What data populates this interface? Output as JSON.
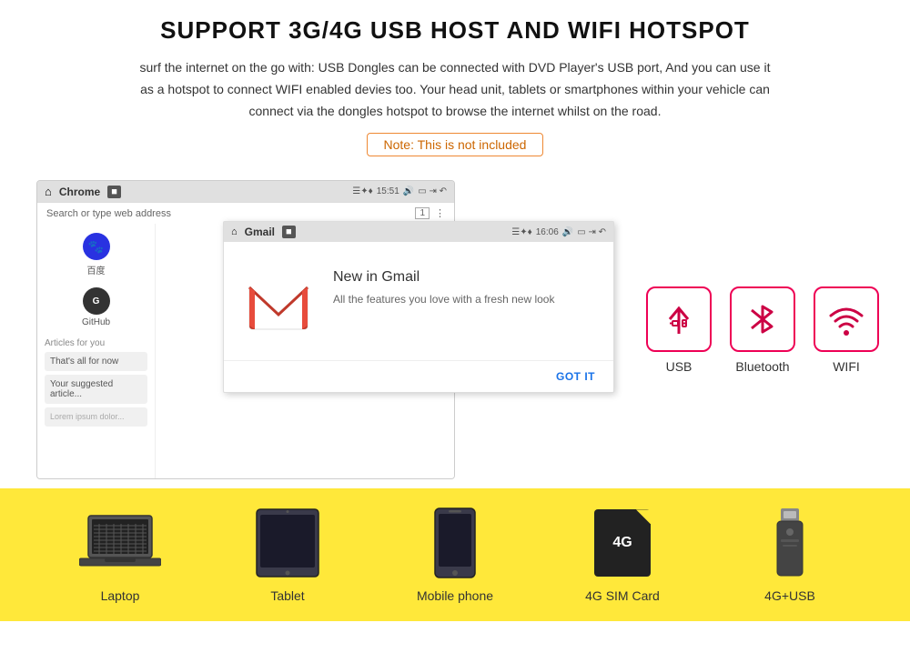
{
  "title": "SUPPORT 3G/4G USB HOST AND WIFI HOTSPOT",
  "description": "surf the internet on the go with: USB Dongles can be connected with DVD Player's USB port, And you can use it as a hotspot to connect WIFI enabled devies too. Your head unit, tablets or smartphones within your vehicle can connect via the dongles hotspot to browse the internet whilst on the road.",
  "note": "Note: This is not included",
  "browser": {
    "home_icon": "⌂",
    "title": "Chrome",
    "time": "15:51",
    "address_placeholder": "Search or type web address"
  },
  "gmail": {
    "title": "Gmail",
    "time": "16:06",
    "heading": "New in Gmail",
    "body": "All the features you love with a fresh new look",
    "cta": "GOT IT"
  },
  "sidebar_apps": [
    {
      "name": "百度",
      "icon": "🐾"
    },
    {
      "name": "GitHub",
      "icon": "G"
    }
  ],
  "articles_label": "Articles for you",
  "news_items": [
    "That's all for now",
    "Your suggested article..."
  ],
  "connectivity_icons": [
    {
      "label": "USB",
      "icon": "⚡",
      "type": "usb"
    },
    {
      "label": "Bluetooth",
      "icon": "✳",
      "type": "bluetooth"
    },
    {
      "label": "WIFI",
      "icon": "📶",
      "type": "wifi"
    }
  ],
  "bottom_items": [
    {
      "label": "Laptop",
      "type": "laptop"
    },
    {
      "label": "Tablet",
      "type": "tablet"
    },
    {
      "label": "Mobile phone",
      "type": "phone"
    },
    {
      "label": "4G SIM Card",
      "type": "sim"
    },
    {
      "label": "4G+USB",
      "type": "usb_dongle"
    }
  ],
  "colors": {
    "accent_red": "#e0055a",
    "accent_border": "#cc0044",
    "yellow_bg": "#ffe83a",
    "note_color": "#cc6600"
  }
}
